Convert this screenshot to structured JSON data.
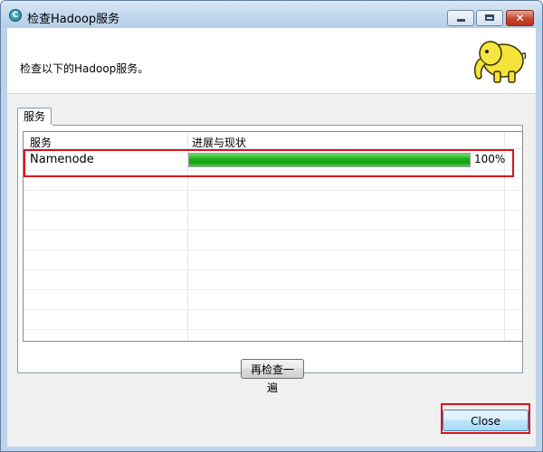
{
  "window": {
    "title": "检查Hadoop服务",
    "app_icon": "hadoop-tool-icon",
    "controls": {
      "minimize": "minimize-icon",
      "maximize": "maximize-icon",
      "close": "close-icon"
    }
  },
  "header": {
    "text": "检查以下的Hadoop服务。",
    "logo": "hadoop-elephant-logo"
  },
  "tabs": [
    {
      "label": "服务"
    }
  ],
  "table": {
    "columns": [
      "服务",
      "进展与现状"
    ],
    "rows": [
      {
        "service": "Namenode",
        "progress": 1.0,
        "status": "100%"
      }
    ]
  },
  "buttons": {
    "recheck": "再检查一遍",
    "close": "Close"
  },
  "colors": {
    "progress_green": "#20b020",
    "highlight_red": "#e0101a",
    "title_bar": "#c1d6ee"
  }
}
